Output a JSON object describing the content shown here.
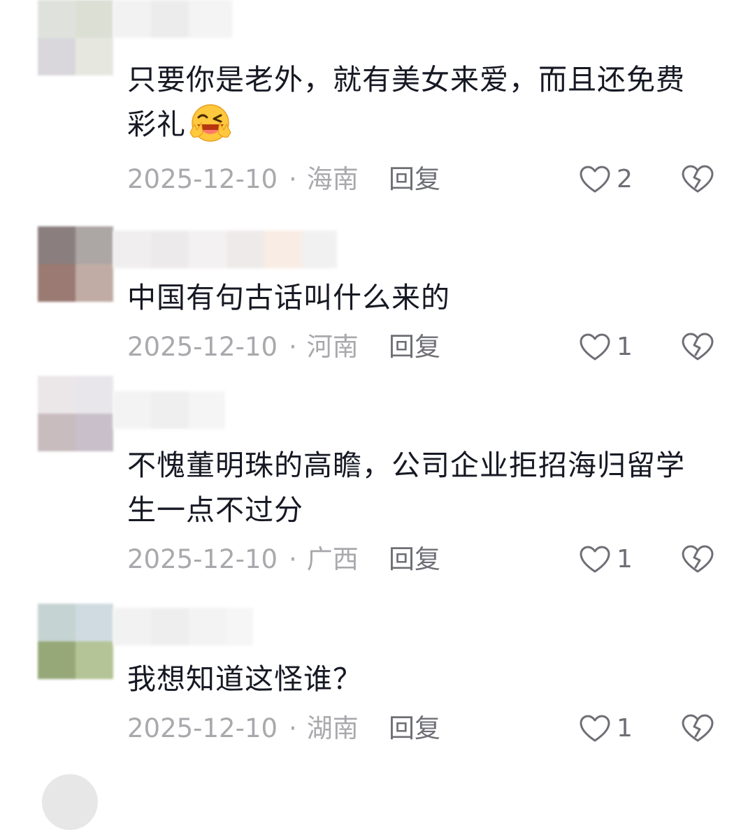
{
  "comments": [
    {
      "text": "只要你是老外，就有美女来爱，而且还免费彩礼",
      "emoji": "laughing-wink-emoji",
      "date": "2025-12-10",
      "location": "海南",
      "reply_label": "回复",
      "like_count": "2"
    },
    {
      "text": "中国有句古话叫什么来的",
      "date": "2025-12-10",
      "location": "河南",
      "reply_label": "回复",
      "like_count": "1"
    },
    {
      "text": "不愧董明珠的高瞻，公司企业拒招海归留学生一点不过分",
      "date": "2025-12-10",
      "location": "广西",
      "reply_label": "回复",
      "like_count": "1"
    },
    {
      "text": "我想知道这怪谁？",
      "date": "2025-12-10",
      "location": "湖南",
      "reply_label": "回复",
      "like_count": "1"
    }
  ],
  "meta_separator": "·",
  "colors": {
    "text": "#161823",
    "meta": "#a9a9ad",
    "action": "#6e6f75"
  },
  "icons": {
    "like": "heart-outline-icon",
    "dislike": "broken-heart-icon"
  }
}
